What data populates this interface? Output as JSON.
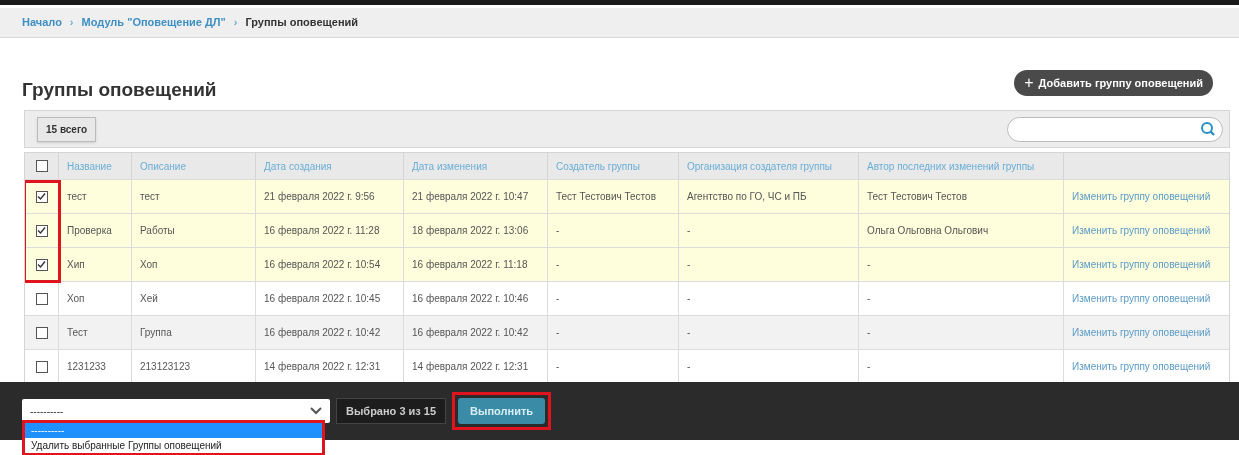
{
  "breadcrumbs": [
    {
      "label": "Начало",
      "current": false
    },
    {
      "label": "Модуль \"Оповещение ДЛ\"",
      "current": false
    },
    {
      "label": "Группы оповещений",
      "current": true
    }
  ],
  "breadcrumb_separator": "›",
  "title": "Группы оповещений",
  "add_button": {
    "icon": "+",
    "label": "Добавить группу оповещений"
  },
  "total_badge": "15 всего",
  "table": {
    "select_all_checked": false,
    "columns": [
      "Название",
      "Описание",
      "Дата создания",
      "Дата изменения",
      "Создатель группы",
      "Организация создателя группы",
      "Автор последних изменений группы"
    ],
    "rows": [
      {
        "checked": true,
        "cells": [
          "тест",
          "тест",
          "21 февраля 2022 г. 9:56",
          "21 февраля 2022 г. 10:47",
          "Тест Тестович Тестов",
          "Агентство по ГО, ЧС и ПБ",
          "Тест Тестович Тестов"
        ],
        "action": "Изменить группу оповещений"
      },
      {
        "checked": true,
        "cells": [
          "Проверка",
          "Работы",
          "16 февраля 2022 г. 11:28",
          "18 февраля 2022 г. 13:06",
          "-",
          "-",
          "Ольга Ольговна Ольгович"
        ],
        "action": "Изменить группу оповещений"
      },
      {
        "checked": true,
        "cells": [
          "Хип",
          "Хоп",
          "16 февраля 2022 г. 10:54",
          "16 февраля 2022 г. 11:18",
          "-",
          "-",
          "-"
        ],
        "action": "Изменить группу оповещений"
      },
      {
        "checked": false,
        "cells": [
          "Хоп",
          "Хей",
          "16 февраля 2022 г. 10:45",
          "16 февраля 2022 г. 10:46",
          "-",
          "-",
          "-"
        ],
        "action": "Изменить группу оповещений"
      },
      {
        "checked": false,
        "cells": [
          "Тест",
          "Группа",
          "16 февраля 2022 г. 10:42",
          "16 февраля 2022 г. 10:42",
          "-",
          "-",
          "-"
        ],
        "action": "Изменить группу оповещений"
      },
      {
        "checked": false,
        "cells": [
          "1231233",
          "213123123",
          "14 февраля 2022 г. 12:31",
          "14 февраля 2022 г. 12:31",
          "-",
          "-",
          "-"
        ],
        "action": "Изменить группу оповещений"
      }
    ]
  },
  "action_bar": {
    "select_value": "----------",
    "expanded": true,
    "options": [
      {
        "label": "----------",
        "selected": true
      },
      {
        "label": "Удалить выбранные Группы оповещений",
        "selected": false
      }
    ],
    "selection_count": "Выбрано 3 из 15",
    "run_button": "Выполнить"
  },
  "highlights": {
    "checkboxes": true,
    "select": true,
    "run_button": true
  }
}
